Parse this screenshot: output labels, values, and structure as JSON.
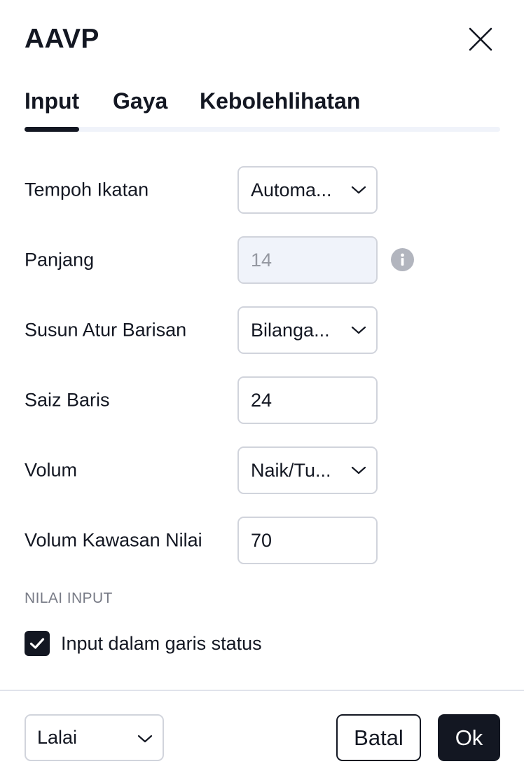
{
  "dialog": {
    "title": "AAVP",
    "close_icon": "close-icon"
  },
  "tabs": [
    {
      "label": "Input",
      "active": true
    },
    {
      "label": "Gaya",
      "active": false
    },
    {
      "label": "Kebolehlihatan",
      "active": false
    }
  ],
  "fields": {
    "tempoh_ikatan": {
      "label": "Tempoh Ikatan",
      "value": "Automa...",
      "type": "select"
    },
    "panjang": {
      "label": "Panjang",
      "value": "14",
      "type": "input",
      "disabled": true,
      "icon": "info-icon"
    },
    "susun_atur": {
      "label": "Susun Atur Barisan",
      "value": "Bilanga...",
      "type": "select"
    },
    "saiz_baris": {
      "label": "Saiz Baris",
      "value": "24",
      "type": "input"
    },
    "volum": {
      "label": "Volum",
      "value": "Naik/Tu...",
      "type": "select"
    },
    "volum_kawasan": {
      "label": "Volum Kawasan Nilai",
      "value": "70",
      "type": "input"
    }
  },
  "section": {
    "header": "NILAI INPUT",
    "checkbox_label": "Input dalam garis status",
    "checkbox_checked": true
  },
  "footer": {
    "preset_value": "Lalai",
    "cancel_label": "Batal",
    "ok_label": "Ok"
  },
  "colors": {
    "text": "#131722",
    "border": "#d1d4dc",
    "muted": "#787b86",
    "disabled_bg": "#f0f3fa",
    "primary": "#131722"
  }
}
